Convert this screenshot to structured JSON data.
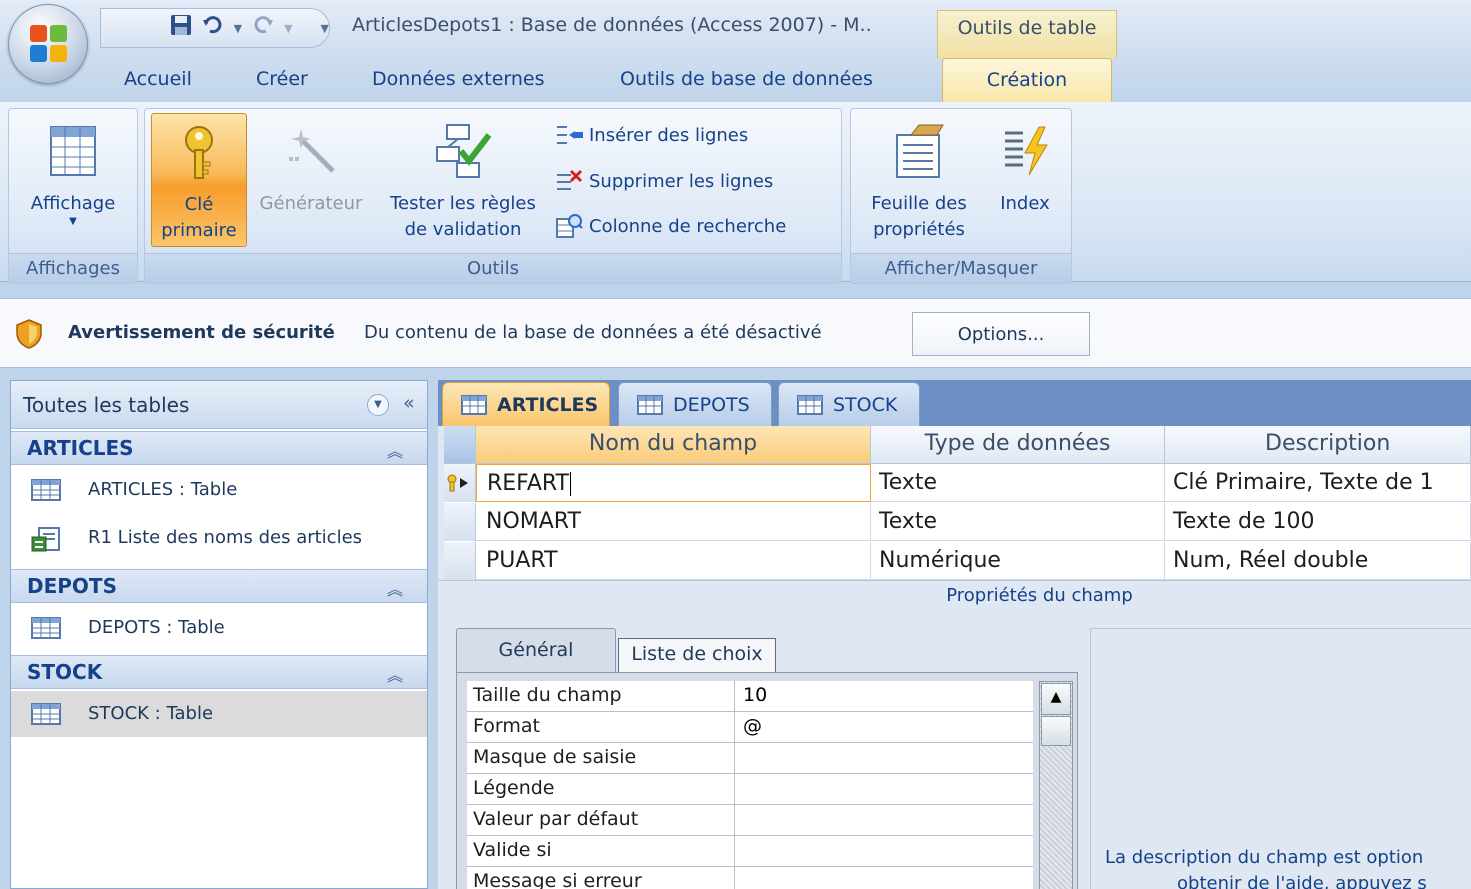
{
  "title_bar": {
    "title": "ArticlesDepots1 : Base de données (Access 2007) - M..",
    "context_tab_header": "Outils de table"
  },
  "ribbon_tabs": [
    "Accueil",
    "Créer",
    "Données externes",
    "Outils de base de données",
    "Création"
  ],
  "ribbon": {
    "groups": {
      "affichages": "Affichages",
      "outils": "Outils",
      "afficher_masquer": "Afficher/Masquer"
    },
    "buttons": {
      "affichage": "Affichage",
      "cle_line1": "Clé",
      "cle_line2": "primaire",
      "generateur": "Générateur",
      "tester_line1": "Tester les règles",
      "tester_line2": "de validation",
      "inserer": "Insérer des lignes",
      "supprimer": "Supprimer les lignes",
      "colonne": "Colonne de recherche",
      "feuille_line1": "Feuille des",
      "feuille_line2": "propriétés",
      "index": "Index"
    }
  },
  "security_bar": {
    "title": "Avertissement de sécurité",
    "message": "Du contenu de la base de données a été désactivé",
    "options_button": "Options..."
  },
  "nav_pane": {
    "title": "Toutes les tables",
    "groups": [
      {
        "label": "ARTICLES",
        "items": [
          "ARTICLES : Table",
          "R1 Liste des noms des articles"
        ]
      },
      {
        "label": "DEPOTS",
        "items": [
          "DEPOTS : Table"
        ]
      },
      {
        "label": "STOCK",
        "items": [
          "STOCK : Table"
        ]
      }
    ]
  },
  "doc_tabs": [
    "ARTICLES",
    "DEPOTS",
    "STOCK"
  ],
  "field_grid": {
    "headers": [
      "Nom du champ",
      "Type de données",
      "Description"
    ],
    "rows": [
      {
        "name": "REFART",
        "type": "Texte",
        "description": "Clé Primaire, Texte de 1"
      },
      {
        "name": "NOMART",
        "type": "Texte",
        "description": "Texte de 100"
      },
      {
        "name": "PUART",
        "type": "Numérique",
        "description": "Num, Réel double"
      }
    ]
  },
  "field_properties": {
    "title": "Propriétés du champ",
    "tabs": [
      "Général",
      "Liste de choix"
    ],
    "rows": [
      {
        "label": "Taille du champ",
        "value": "10"
      },
      {
        "label": "Format",
        "value": "@"
      },
      {
        "label": "Masque de saisie",
        "value": ""
      },
      {
        "label": "Légende",
        "value": ""
      },
      {
        "label": "Valeur par défaut",
        "value": ""
      },
      {
        "label": "Valide si",
        "value": ""
      },
      {
        "label": "Message si erreur",
        "value": ""
      }
    ],
    "help_line1": "La description du champ est option",
    "help_line2": "obtenir de l'aide, appuyez s"
  }
}
